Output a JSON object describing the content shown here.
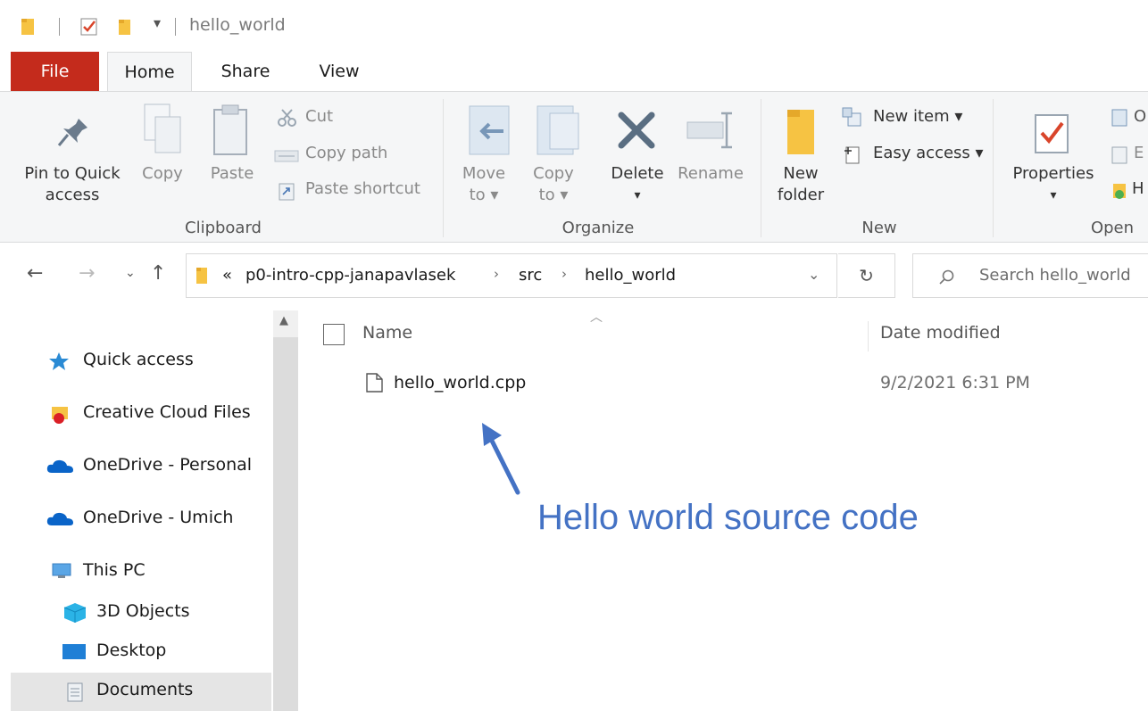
{
  "window": {
    "title": "hello_world"
  },
  "tabs": {
    "file": "File",
    "home": "Home",
    "share": "Share",
    "view": "View"
  },
  "ribbon": {
    "clipboard": {
      "label": "Clipboard",
      "pin_line1": "Pin to Quick",
      "pin_line2": "access",
      "copy": "Copy",
      "paste": "Paste",
      "cut": "Cut",
      "copy_path": "Copy path",
      "paste_shortcut": "Paste shortcut"
    },
    "organize": {
      "label": "Organize",
      "move_line1": "Move",
      "move_line2": "to",
      "copy_line1": "Copy",
      "copy_line2": "to",
      "delete": "Delete",
      "rename": "Rename"
    },
    "new": {
      "label": "New",
      "folder_line1": "New",
      "folder_line2": "folder",
      "new_item": "New item",
      "easy_access": "Easy access"
    },
    "open": {
      "label": "Open",
      "properties": "Properties",
      "open_partial": "O",
      "edit_partial": "E",
      "history_partial": "H"
    }
  },
  "address": {
    "overflow": "«",
    "crumbs": [
      "p0-intro-cpp-janapavlasek",
      "src",
      "hello_world"
    ],
    "search_placeholder": "Search hello_world"
  },
  "nav": {
    "items": [
      {
        "label": "Quick access",
        "icon": "star-icon"
      },
      {
        "label": "Creative Cloud Files",
        "icon": "creative-cloud-icon"
      },
      {
        "label": "OneDrive - Personal",
        "icon": "cloud-icon"
      },
      {
        "label": "OneDrive - Umich",
        "icon": "cloud-icon"
      },
      {
        "label": "This PC",
        "icon": "computer-icon"
      },
      {
        "label": "3D Objects",
        "icon": "cube-icon"
      },
      {
        "label": "Desktop",
        "icon": "desktop-icon"
      },
      {
        "label": "Documents",
        "icon": "document-icon"
      }
    ]
  },
  "files": {
    "columns": {
      "name": "Name",
      "date": "Date modified"
    },
    "rows": [
      {
        "name": "hello_world.cpp",
        "date": "9/2/2021 6:31 PM"
      }
    ]
  },
  "annotation": {
    "text": "Hello world source code"
  },
  "colors": {
    "file_tab": "#c42b1c",
    "annotation": "#4472c4",
    "accent": "#0078d7"
  }
}
